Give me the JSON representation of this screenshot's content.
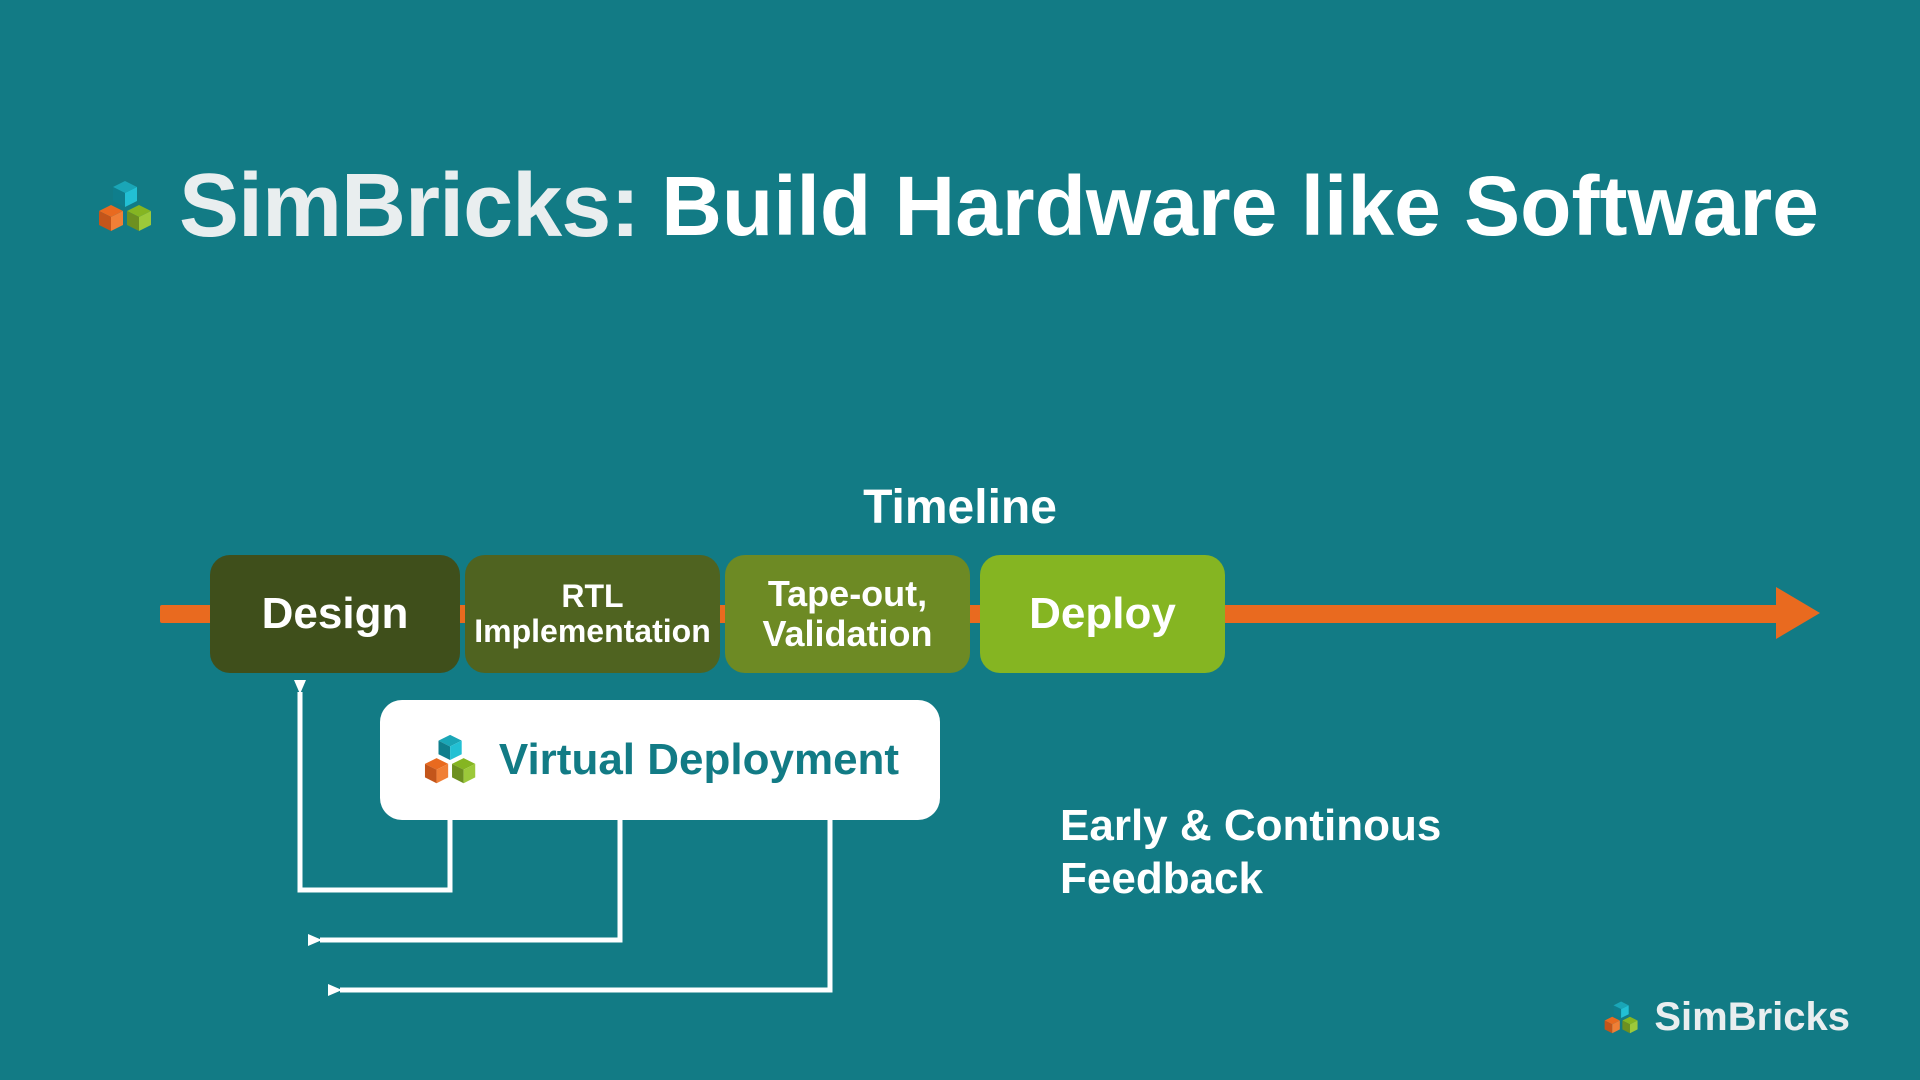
{
  "brand": "SimBricks",
  "title_rest": "Build Hardware like Software",
  "timeline_label": "Timeline",
  "phases": [
    {
      "label": "Design"
    },
    {
      "line1": "RTL",
      "line2": "Implementation"
    },
    {
      "line1": "Tape-out,",
      "line2": "Validation"
    },
    {
      "label": "Deploy"
    }
  ],
  "virtual_deployment": "Virtual Deployment",
  "feedback": {
    "line1": "Early & Continous",
    "line2": "Feedback"
  },
  "colors": {
    "bg": "#127b85",
    "arrow": "#e96a1f",
    "phase1": "#3f4f1b",
    "phase2": "#4f6320",
    "phase3": "#6d8a24",
    "phase4": "#85b522",
    "white": "#ffffff"
  },
  "footer_brand": "SimBricks"
}
